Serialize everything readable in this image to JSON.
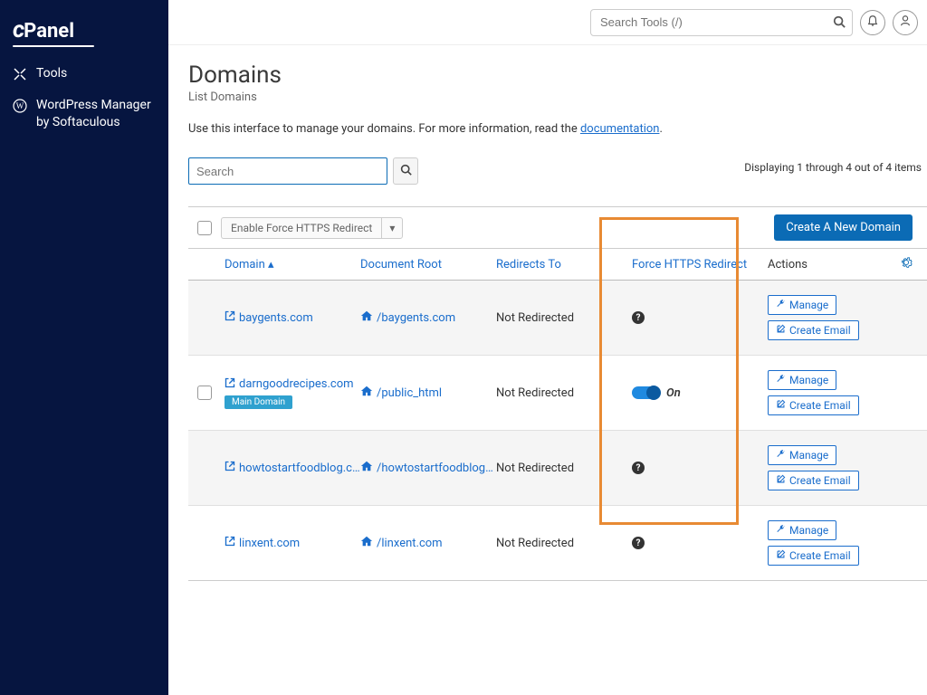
{
  "brand": "cPanel",
  "sidebar": {
    "items": [
      {
        "label": "Tools"
      },
      {
        "label": "WordPress Manager by Softaculous"
      }
    ]
  },
  "topbar": {
    "search_placeholder": "Search Tools (/)"
  },
  "page": {
    "title": "Domains",
    "subtitle": "List Domains",
    "intro_pre": "Use this interface to manage your domains. For more information, read the ",
    "intro_link": "documentation",
    "intro_post": "."
  },
  "filter": {
    "placeholder": "Search"
  },
  "display_text": "Displaying 1 through 4 out of 4 items",
  "bulk": {
    "enable_https": "Enable Force HTTPS Redirect"
  },
  "create_btn": "Create A New Domain",
  "columns": {
    "domain": "Domain",
    "root": "Document Root",
    "redirects": "Redirects To",
    "https": "Force HTTPS Redirect",
    "actions": "Actions"
  },
  "actions": {
    "manage": "Manage",
    "create_email": "Create Email",
    "main_badge": "Main Domain"
  },
  "toggle": {
    "on": "On"
  },
  "rows": [
    {
      "domain": "baygents.com",
      "root": "/baygents.com",
      "redirect": "Not Redirected",
      "https": "help",
      "checkbox": false,
      "main": false
    },
    {
      "domain": "darngoodrecipes.com",
      "root": "/public_html",
      "redirect": "Not Redirected",
      "https": "on",
      "checkbox": true,
      "main": true
    },
    {
      "domain": "howtostartfoodblog.c…",
      "root": "/howtostartfoodblog…",
      "redirect": "Not Redirected",
      "https": "help",
      "checkbox": false,
      "main": false
    },
    {
      "domain": "linxent.com",
      "root": "/linxent.com",
      "redirect": "Not Redirected",
      "https": "help",
      "checkbox": false,
      "main": false
    }
  ]
}
